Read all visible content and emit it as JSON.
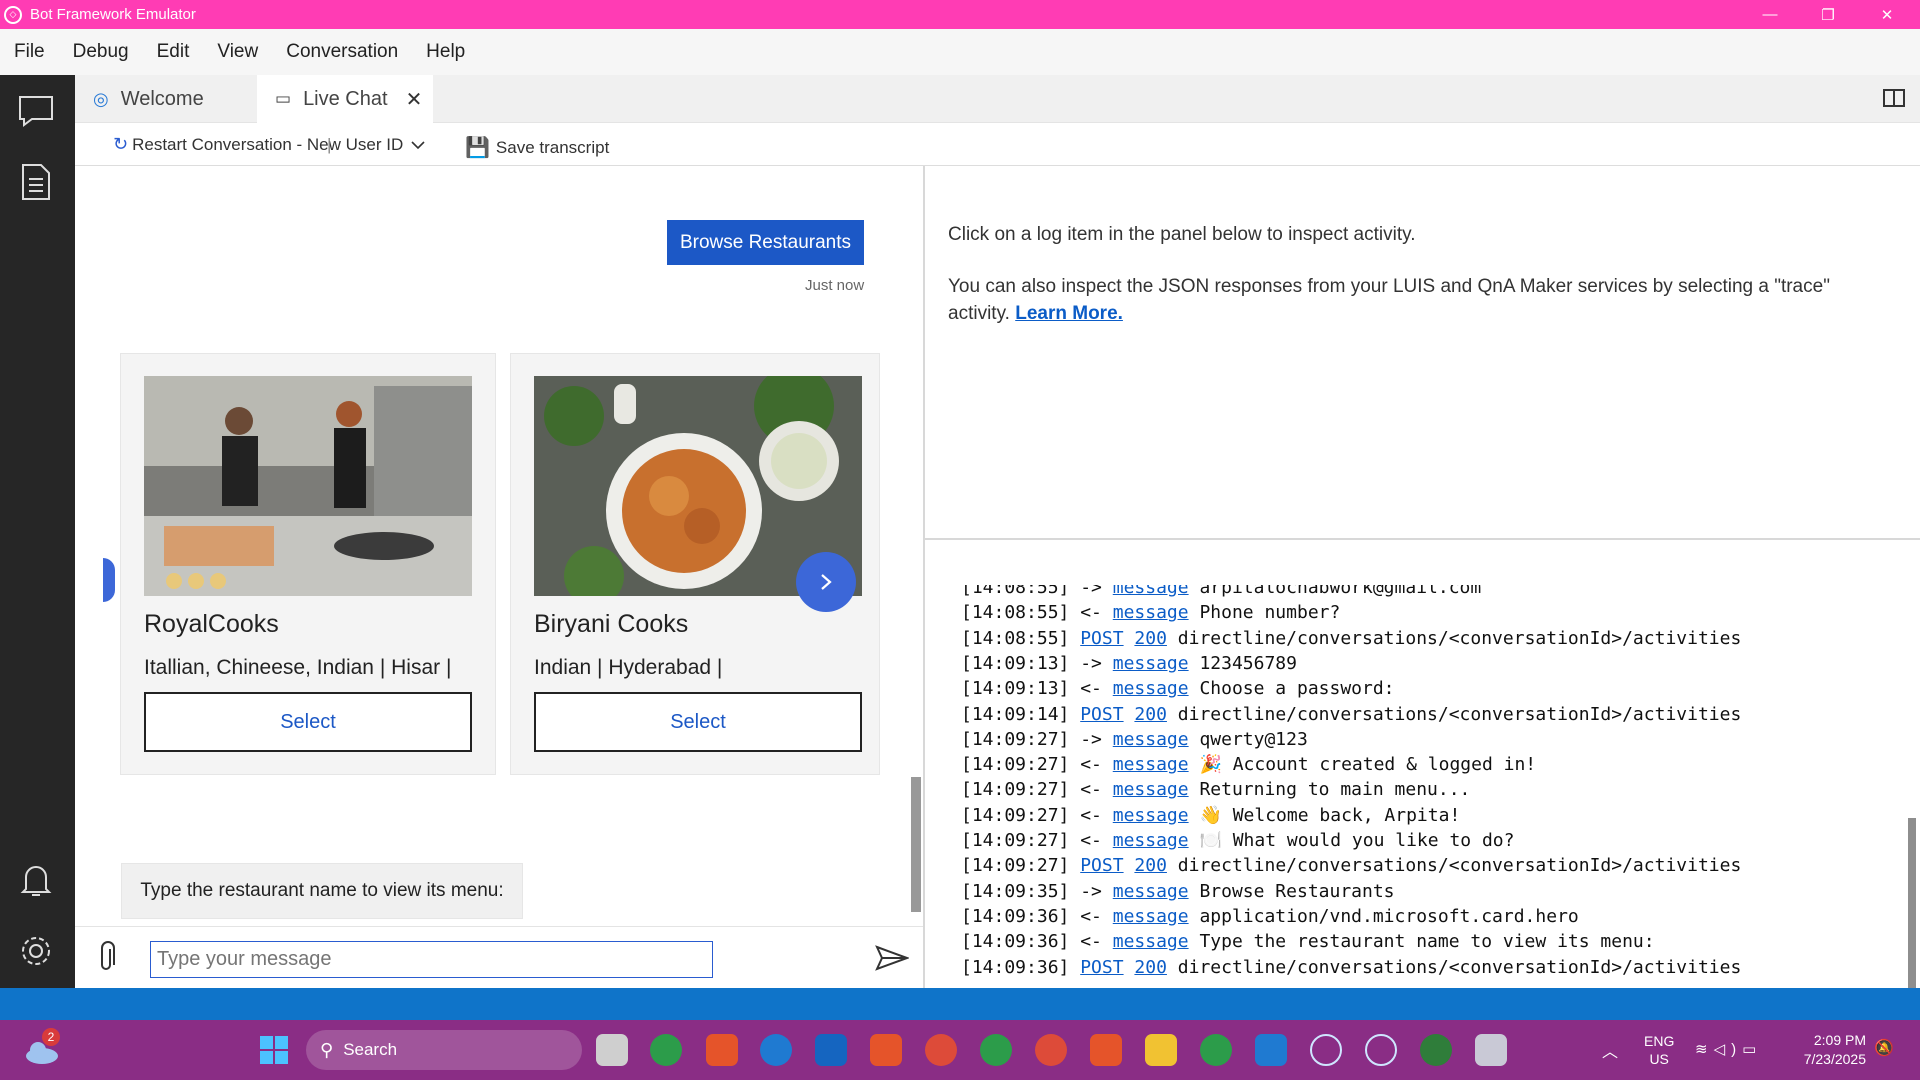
{
  "window": {
    "title": "Bot Framework Emulator"
  },
  "menu": [
    "File",
    "Debug",
    "Edit",
    "View",
    "Conversation",
    "Help"
  ],
  "tabs": [
    {
      "label": "Welcome"
    },
    {
      "label": "Live Chat",
      "close": "✕"
    }
  ],
  "toolbar": {
    "restart_label": "Restart Conversation - New User ID",
    "save_label": "Save transcript"
  },
  "chat": {
    "user_message": "Browse Restaurants",
    "timestamp": "Just now",
    "cards": [
      {
        "title": "RoyalCooks",
        "subtitle": "Itallian, Chineese, Indian | Hisar |",
        "button": "Select"
      },
      {
        "title": "Biryani Cooks",
        "subtitle": "Indian | Hyderabad |",
        "button": "Select"
      }
    ],
    "bot_message": "Type the restaurant name to view its menu:",
    "input_placeholder": "Type your message"
  },
  "inspector": {
    "line1": "Click on a log item in the panel below to inspect activity.",
    "line2": "You can also inspect the JSON responses from your LUIS and QnA Maker services by selecting a \"trace\"",
    "line3": "activity.",
    "learn_more": "Learn More."
  },
  "log": [
    {
      "time": "[14:08:55]",
      "dir": "->",
      "kind": "message",
      "text": "arpitalochabwork@gmail.com"
    },
    {
      "time": "[14:08:55]",
      "dir": "<-",
      "kind": "message",
      "text": "Phone number?"
    },
    {
      "time": "[14:08:55]",
      "dir": "",
      "kind": "POST",
      "code": "200",
      "text": "directline/conversations/<conversationId>/activities"
    },
    {
      "time": "[14:09:13]",
      "dir": "->",
      "kind": "message",
      "text": "123456789"
    },
    {
      "time": "[14:09:13]",
      "dir": "<-",
      "kind": "message",
      "text": "Choose a password:"
    },
    {
      "time": "[14:09:14]",
      "dir": "",
      "kind": "POST",
      "code": "200",
      "text": "directline/conversations/<conversationId>/activities"
    },
    {
      "time": "[14:09:27]",
      "dir": "->",
      "kind": "message",
      "text": "qwerty@123"
    },
    {
      "time": "[14:09:27]",
      "dir": "<-",
      "kind": "message",
      "text": "🎉 Account created & logged in!"
    },
    {
      "time": "[14:09:27]",
      "dir": "<-",
      "kind": "message",
      "text": "Returning to main menu..."
    },
    {
      "time": "[14:09:27]",
      "dir": "<-",
      "kind": "message",
      "text": "👋 Welcome back, Arpita!"
    },
    {
      "time": "[14:09:27]",
      "dir": "<-",
      "kind": "message",
      "text": "🍽️ What would you like to do?"
    },
    {
      "time": "[14:09:27]",
      "dir": "",
      "kind": "POST",
      "code": "200",
      "text": "directline/conversations/<conversationId>/activities"
    },
    {
      "time": "[14:09:35]",
      "dir": "->",
      "kind": "message",
      "text": "Browse Restaurants"
    },
    {
      "time": "[14:09:36]",
      "dir": "<-",
      "kind": "message",
      "text": "application/vnd.microsoft.card.hero"
    },
    {
      "time": "[14:09:36]",
      "dir": "<-",
      "kind": "message",
      "text": "Type the restaurant name to view its menu:"
    },
    {
      "time": "[14:09:36]",
      "dir": "",
      "kind": "POST",
      "code": "200",
      "text": "directline/conversations/<conversationId>/activities"
    }
  ],
  "taskbar": {
    "search_label": "Search",
    "weather_badge": "2",
    "language": "ENG",
    "region": "US",
    "time": "2:09 PM",
    "date": "7/23/2025"
  },
  "colors": {
    "titlebar": "#ff3cb4",
    "accent": "#1c58c6",
    "statusbar": "#0f74c9",
    "taskbar": "#8a2d85"
  }
}
